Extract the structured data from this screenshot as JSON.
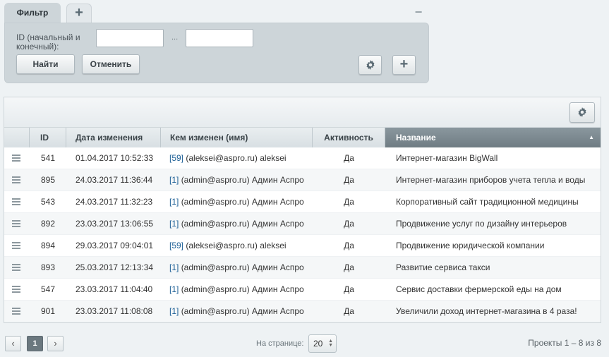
{
  "filter": {
    "tab_label": "Фильтр",
    "add_tab_label": "+",
    "collapse_label": "−",
    "field_label": "ID (начальный и конечный):",
    "range_separator": "...",
    "from_value": "",
    "to_value": "",
    "find_label": "Найти",
    "cancel_label": "Отменить",
    "add_label": "+"
  },
  "grid": {
    "columns": {
      "id": "ID",
      "date": "Дата изменения",
      "modified_by": "Кем изменен (имя)",
      "active": "Активность",
      "name": "Название"
    },
    "sorted_column": "name",
    "sort_direction": "asc",
    "rows": [
      {
        "id": "541",
        "date": "01.04.2017 10:52:33",
        "user_id": "[59]",
        "user_name": "(aleksei@aspro.ru) aleksei",
        "active": "Да",
        "name": "Интернет-магазин BigWall"
      },
      {
        "id": "895",
        "date": "24.03.2017 11:36:44",
        "user_id": "[1]",
        "user_name": "(admin@aspro.ru) Админ Аспро",
        "active": "Да",
        "name": "Интернет-магазин приборов учета тепла и воды"
      },
      {
        "id": "543",
        "date": "24.03.2017 11:32:23",
        "user_id": "[1]",
        "user_name": "(admin@aspro.ru) Админ Аспро",
        "active": "Да",
        "name": "Корпоративный сайт традиционной медицины"
      },
      {
        "id": "892",
        "date": "23.03.2017 13:06:55",
        "user_id": "[1]",
        "user_name": "(admin@aspro.ru) Админ Аспро",
        "active": "Да",
        "name": "Продвижение услуг по дизайну интерьеров"
      },
      {
        "id": "894",
        "date": "29.03.2017 09:04:01",
        "user_id": "[59]",
        "user_name": "(aleksei@aspro.ru) aleksei",
        "active": "Да",
        "name": "Продвижение юридической компании"
      },
      {
        "id": "893",
        "date": "25.03.2017 12:13:34",
        "user_id": "[1]",
        "user_name": "(admin@aspro.ru) Админ Аспро",
        "active": "Да",
        "name": "Развитие сервиса такси"
      },
      {
        "id": "547",
        "date": "23.03.2017 11:04:40",
        "user_id": "[1]",
        "user_name": "(admin@aspro.ru) Админ Аспро",
        "active": "Да",
        "name": "Сервис доставки фермерской еды на дом"
      },
      {
        "id": "901",
        "date": "23.03.2017 11:08:08",
        "user_id": "[1]",
        "user_name": "(admin@aspro.ru) Админ Аспро",
        "active": "Да",
        "name": "Увеличили доход интернет-магазина в 4 раза!"
      }
    ]
  },
  "pagination": {
    "prev": "‹",
    "current_page": "1",
    "next": "›",
    "per_page_label": "На странице:",
    "per_page_value": "20",
    "summary": "Проекты 1 – 8 из 8"
  },
  "icons": {
    "settings": "gear-icon",
    "add": "plus-icon",
    "row_menu": "hamburger-menu-icon",
    "sort": "sort-up-icon"
  },
  "colors": {
    "page_bg": "#eef2f4",
    "filter_bg": "#cdd5d9",
    "sorted_header_bg": "#7b888f",
    "user_id_link": "#1b5e95"
  }
}
